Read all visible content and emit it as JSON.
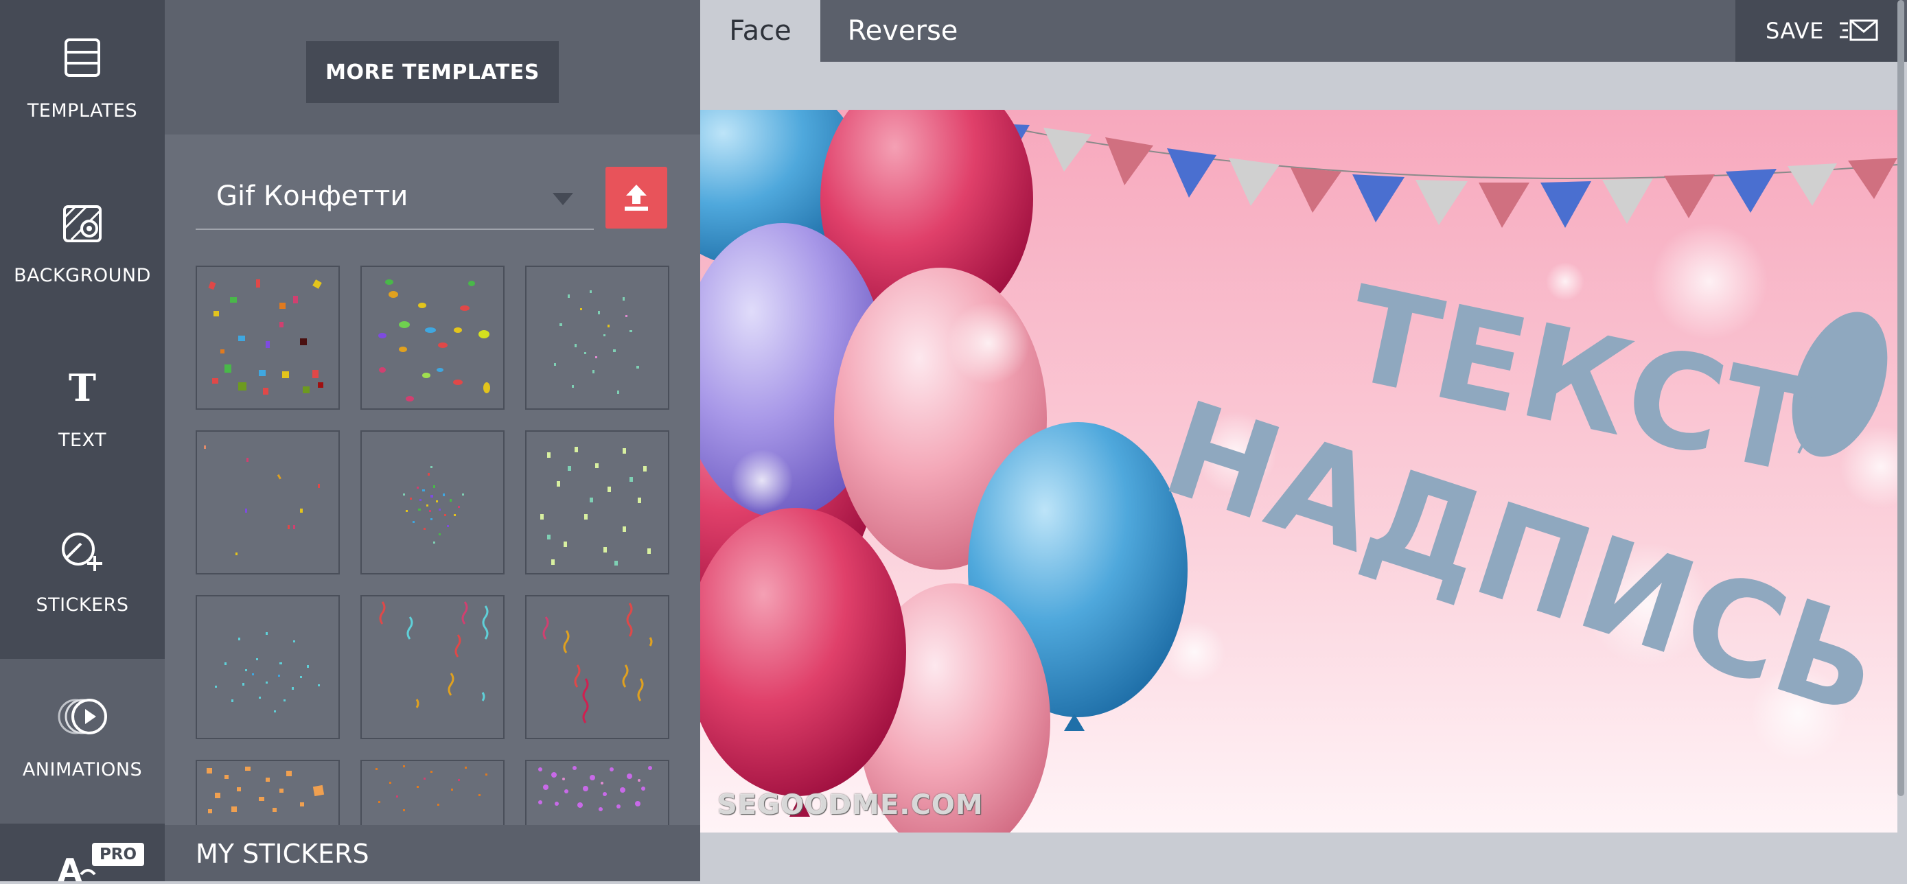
{
  "nav": {
    "items": [
      {
        "label": "TEMPLATES",
        "icon": "templates-icon"
      },
      {
        "label": "BACKGROUND",
        "icon": "background-icon"
      },
      {
        "label": "TEXT",
        "icon": "text-icon"
      },
      {
        "label": "STICKERS",
        "icon": "stickers-icon"
      },
      {
        "label": "ANIMATIONS",
        "icon": "animations-icon",
        "active": true
      }
    ],
    "pro_badge": "PRO"
  },
  "panel": {
    "more_templates": "MORE TEMPLATES",
    "category_selected": "Gif Конфетти",
    "my_stickers": "MY STICKERS"
  },
  "editor": {
    "tabs": [
      {
        "label": "Face",
        "active": true
      },
      {
        "label": "Reverse",
        "active": false
      }
    ],
    "save_label": "SAVE",
    "card_text_line1": "ТЕКСТ",
    "card_text_line2": "НАДПИСЬ",
    "watermark": "SEGOODME.COM"
  },
  "colors": {
    "nav_bg": "#454a55",
    "panel_bg": "#696e79",
    "upload_red": "#e8535a",
    "card_pink": "#f7c6d2",
    "card_text": "#8fa8bf"
  }
}
